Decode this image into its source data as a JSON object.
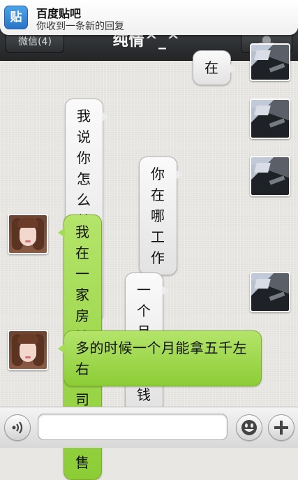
{
  "notification": {
    "app_icon_char": "贴",
    "title": "百度贴吧",
    "body": "你收到一条新的回复",
    "icon_color": "#3b8ddb"
  },
  "navbar": {
    "back_label": "微信(4)",
    "title": "纯情^_^",
    "profile_icon": "person-icon"
  },
  "messages": [
    {
      "side": "right",
      "text": "在",
      "avatar": "contact-photo-car"
    },
    {
      "side": "right",
      "text": "我说你怎么就想不开呢",
      "avatar": "contact-photo-car"
    },
    {
      "side": "right",
      "text": "你在哪工作",
      "avatar": "contact-photo-car"
    },
    {
      "side": "left",
      "text": "我在一家房地产公司做销售",
      "avatar": "contact-photo-girl"
    },
    {
      "side": "right",
      "text": "一个月多少钱",
      "avatar": "contact-photo-car"
    },
    {
      "side": "left",
      "text": "多的时候一个月能拿五千左右",
      "avatar": "contact-photo-girl"
    }
  ],
  "input_bar": {
    "voice_icon": "voice-icon",
    "text_value": "",
    "emoji_icon": "emoji-icon",
    "add_icon": "plus-icon"
  },
  "colors": {
    "left_bubble": "#9bd648",
    "right_bubble": "#f0f0f0",
    "navbar": "#2e3033"
  }
}
